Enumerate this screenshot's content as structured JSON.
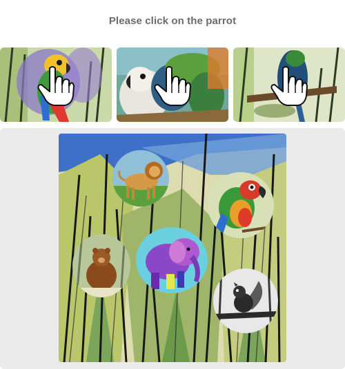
{
  "captcha": {
    "instruction": "Please click on the parrot"
  },
  "examples": [
    {
      "subject": "parrot",
      "icon": "pointer-hand-icon"
    },
    {
      "subject": "parrot",
      "icon": "pointer-hand-icon"
    },
    {
      "subject": "parrot",
      "icon": "pointer-hand-icon"
    }
  ],
  "puzzle": {
    "choices": [
      {
        "animal": "lion"
      },
      {
        "animal": "parrot"
      },
      {
        "animal": "bear"
      },
      {
        "animal": "elephant"
      },
      {
        "animal": "squirrel"
      }
    ]
  },
  "colors": {
    "prompt_text": "#6b6b6b",
    "panel_bg": "#ebebeb"
  }
}
